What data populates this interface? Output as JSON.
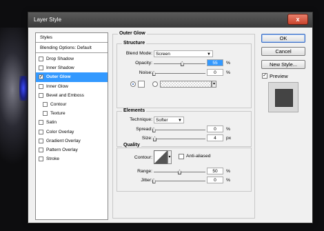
{
  "window": {
    "title": "Layer Style",
    "close_glyph": "x"
  },
  "stylelist": {
    "header": "Styles",
    "blending": "Blending Options: Default",
    "items": [
      {
        "label": "Drop Shadow",
        "checked": false,
        "indent": false,
        "selected": false
      },
      {
        "label": "Inner Shadow",
        "checked": false,
        "indent": false,
        "selected": false
      },
      {
        "label": "Outer Glow",
        "checked": true,
        "indent": false,
        "selected": true
      },
      {
        "label": "Inner Glow",
        "checked": false,
        "indent": false,
        "selected": false
      },
      {
        "label": "Bevel and Emboss",
        "checked": false,
        "indent": false,
        "selected": false
      },
      {
        "label": "Contour",
        "checked": false,
        "indent": true,
        "selected": false
      },
      {
        "label": "Texture",
        "checked": false,
        "indent": true,
        "selected": false
      },
      {
        "label": "Satin",
        "checked": false,
        "indent": false,
        "selected": false
      },
      {
        "label": "Color Overlay",
        "checked": false,
        "indent": false,
        "selected": false
      },
      {
        "label": "Gradient Overlay",
        "checked": false,
        "indent": false,
        "selected": false
      },
      {
        "label": "Pattern Overlay",
        "checked": false,
        "indent": false,
        "selected": false
      },
      {
        "label": "Stroke",
        "checked": false,
        "indent": false,
        "selected": false
      }
    ]
  },
  "panel": {
    "title": "Outer Glow",
    "structure": {
      "title": "Structure",
      "blend_label": "Blend Mode:",
      "blend_value": "Screen",
      "opacity_label": "Opacity:",
      "opacity_value": "55",
      "opacity_unit": "%",
      "opacity_level": 0.55,
      "noise_label": "Noise:",
      "noise_value": "0",
      "noise_unit": "%",
      "noise_level": 0.0
    },
    "elements": {
      "title": "Elements",
      "technique_label": "Technique:",
      "technique_value": "Softer",
      "spread_label": "Spread:",
      "spread_value": "0",
      "spread_unit": "%",
      "spread_level": 0.0,
      "size_label": "Size:",
      "size_value": "4",
      "size_unit": "px",
      "size_level": 0.02
    },
    "quality": {
      "title": "Quality",
      "contour_label": "Contour:",
      "antialiased_label": "Anti-aliased",
      "range_label": "Range:",
      "range_value": "50",
      "range_unit": "%",
      "range_level": 0.5,
      "jitter_label": "Jitter:",
      "jitter_value": "0",
      "jitter_unit": "%",
      "jitter_level": 0.0
    }
  },
  "buttons": {
    "ok": "OK",
    "cancel": "Cancel",
    "new_style": "New Style...",
    "preview": "Preview",
    "preview_checked": true
  },
  "colors": {
    "selection": "#3399ff",
    "titlebar": "#474747"
  }
}
